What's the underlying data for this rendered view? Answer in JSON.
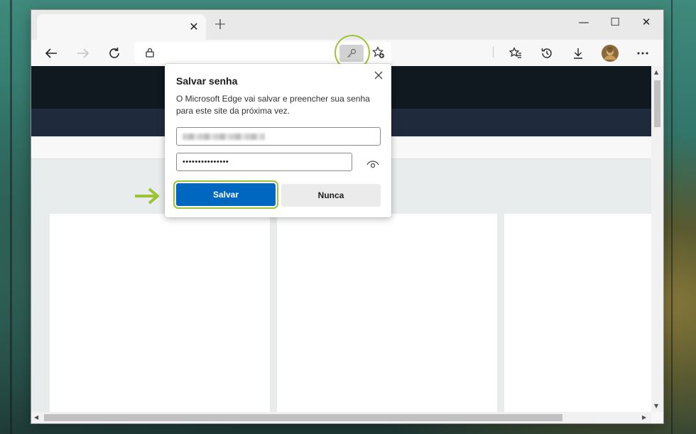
{
  "browser": {
    "tab": {
      "title": "",
      "close_glyph": "✕"
    },
    "new_tab_glyph": "+",
    "window_controls": {
      "minimize": "—",
      "maximize": "☐",
      "close": "✕"
    },
    "address": {
      "value": ""
    }
  },
  "password_prompt": {
    "title": "Salvar senha",
    "description": "O Microsoft Edge vai salvar e preencher sua senha para este site da próxima vez.",
    "password_mask": "•••••••••••••••",
    "save_label": "Salvar",
    "never_label": "Nunca"
  },
  "colors": {
    "primary_button": "#0067c0",
    "highlight_annotation": "#9ac435",
    "site_header": "#101820",
    "site_nav": "#1f2b3d"
  },
  "icons": [
    "back-icon",
    "forward-icon",
    "refresh-icon",
    "lock-icon",
    "key-icon",
    "add-favorite-icon",
    "favorites-icon",
    "history-icon",
    "downloads-icon",
    "profile-avatar",
    "more-icon",
    "close-icon",
    "eye-icon"
  ]
}
